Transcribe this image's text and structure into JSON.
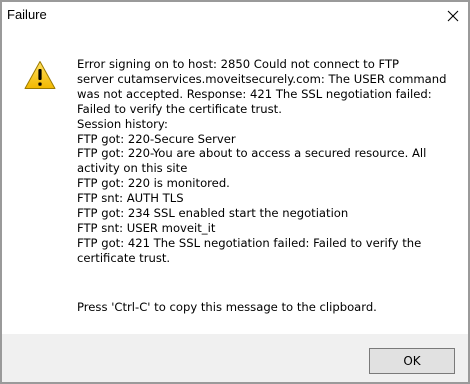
{
  "window": {
    "title": "Failure",
    "close_glyph": "✕"
  },
  "message": {
    "lines": [
      "Error signing on to host: 2850 Could not connect to FTP",
      "server cutamservices.moveitsecurely.com: The USER command",
      "was not accepted. Response: 421 The SSL negotiation failed:",
      "Failed to verify the certificate trust.",
      "Session history:",
      "FTP got: 220-Secure Server",
      "FTP got: 220-You are about to access a secured resource. All",
      "activity on this site",
      "FTP got: 220 is monitored.",
      "FTP snt: AUTH TLS",
      "FTP got: 234 SSL enabled start the negotiation",
      "FTP snt: USER moveit_it",
      "FTP got: 421 The SSL negotiation failed: Failed to verify the",
      "certificate trust."
    ],
    "copy_hint": "Press 'Ctrl-C' to copy this message to the clipboard."
  },
  "buttons": {
    "ok_label": "OK"
  },
  "icons": {
    "warning": "warning-icon",
    "close": "close-icon"
  },
  "colors": {
    "warning_fill": "#f2c811",
    "warning_border": "#8a6d00",
    "footer_bg": "#f0f0f0"
  }
}
